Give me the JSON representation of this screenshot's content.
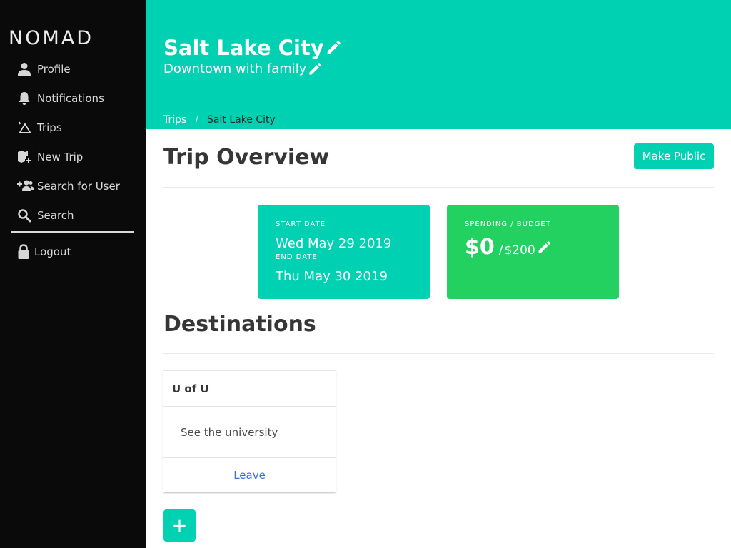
{
  "app": {
    "brand": "NOMAD"
  },
  "sidebar": {
    "items": [
      {
        "label": "Profile",
        "icon": "user-icon"
      },
      {
        "label": "Notifications",
        "icon": "bell-icon"
      },
      {
        "label": "Trips",
        "icon": "tent-icon"
      },
      {
        "label": "New Trip",
        "icon": "map-plus-icon"
      },
      {
        "label": "Search for User",
        "icon": "user-plus-icon"
      },
      {
        "label": "Search",
        "icon": "search-icon"
      },
      {
        "label": "Logout",
        "icon": "lock-icon"
      }
    ]
  },
  "hero": {
    "title": "Salt Lake City",
    "subtitle": "Downtown with family",
    "breadcrumb": {
      "parent": "Trips",
      "separator": "/",
      "current": "Salt Lake City"
    }
  },
  "overview": {
    "title": "Trip Overview",
    "make_public_label": "Make Public",
    "dates": {
      "start_label": "START DATE",
      "start_value": "Wed May 29 2019",
      "end_label": "END DATE",
      "end_value": "Thu May 30 2019"
    },
    "budget": {
      "label": "SPENDING / BUDGET",
      "spent": "$0",
      "separator": "/",
      "total": "$200"
    }
  },
  "destinations": {
    "title": "Destinations",
    "items": [
      {
        "name": "U of U",
        "description": "See the university",
        "action": "Leave"
      }
    ],
    "add_label": "+"
  },
  "colors": {
    "primary": "#00d1b2",
    "success": "#23d160",
    "sidebar_bg": "#0a0a0a",
    "link": "#3273dc"
  }
}
